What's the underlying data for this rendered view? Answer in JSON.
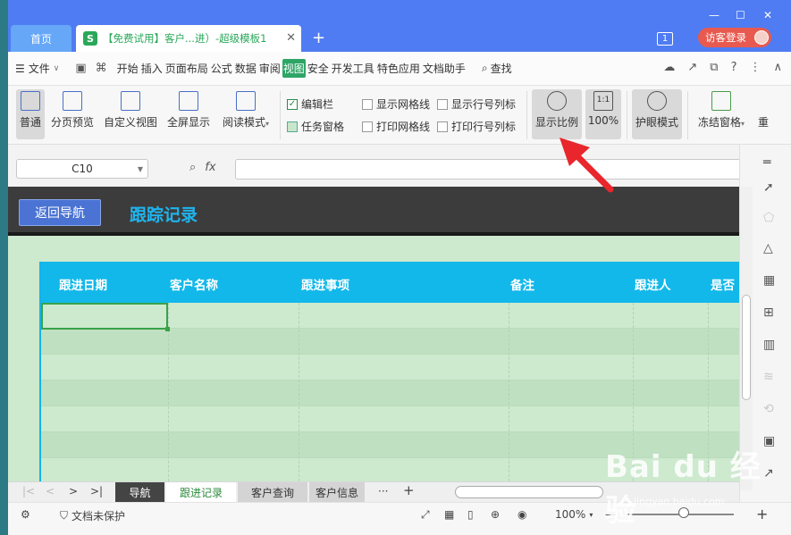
{
  "titlebar": {
    "home_tab": "首页",
    "doc_logo": "S",
    "doc_title": "【免费试用】客户...进）-超级模板1",
    "close": "✕",
    "add_tab": "+",
    "badge": "1",
    "visitor_login": "访客登录",
    "minimize": "—",
    "maximize": "☐",
    "close_window": "✕"
  },
  "menubar": {
    "file": "文件",
    "tabs": [
      "开始",
      "插入",
      "页面布局",
      "公式",
      "数据",
      "审阅",
      "视图",
      "安全",
      "开发工具",
      "特色应用",
      "文档助手"
    ],
    "active_tab": "视图",
    "search": "查找"
  },
  "ribbon": {
    "buttons": [
      "普通",
      "分页预览",
      "自定义视图",
      "全屏显示",
      "阅读模式"
    ],
    "checks": {
      "edit_bar": "编辑栏",
      "task_pane": "任务窗格",
      "show_grid": "显示网格线",
      "show_headers": "显示行号列标",
      "print_grid": "打印网格线",
      "print_headers": "打印行号列标"
    },
    "zoom_ratio": "显示比例",
    "zoom_100": "100%",
    "zoom_100_icon": "1:1",
    "eye_mode": "护眼模式",
    "freeze": "冻结窗格",
    "more": "重"
  },
  "formula_bar": {
    "name_box": "C10",
    "fx": "fx"
  },
  "sheet": {
    "back_button": "返回导航",
    "title": "跟踪记录",
    "columns": [
      "跟进日期",
      "客户名称",
      "跟进事项",
      "备注",
      "跟进人",
      "是否"
    ]
  },
  "sheet_tabs": {
    "tabs": [
      "导航",
      "跟进记录",
      "客户查询",
      "客户信息"
    ],
    "active": "跟进记录",
    "more": "···",
    "add": "+"
  },
  "statusbar": {
    "doc_protect": "文档未保护",
    "zoom": "100%",
    "zoom_minus": "—",
    "zoom_plus": "+"
  },
  "watermark": {
    "brand": "Bai du 经验",
    "url": "jingyan.baidu.com"
  },
  "colors": {
    "titlebar": "#4f7cf2",
    "active_menu": "#2ea566",
    "sheet_bg": "#cde9ce",
    "table_header": "#13b8ea",
    "sheet_title": "#1fb4ee",
    "arrow": "#e8262b"
  }
}
